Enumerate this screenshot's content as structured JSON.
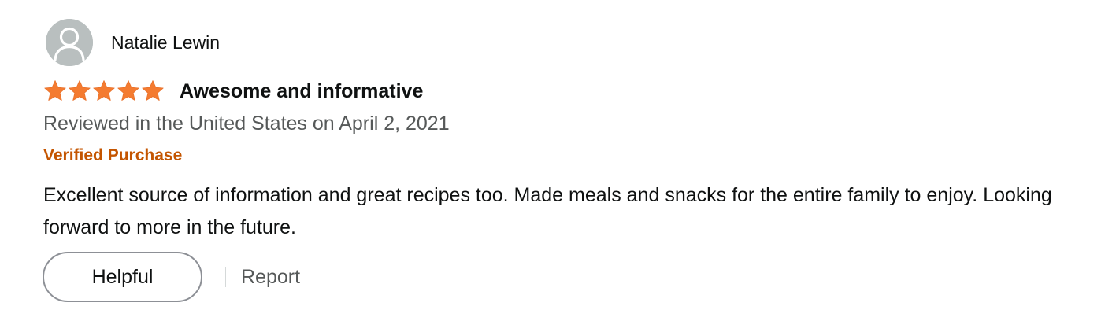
{
  "colors": {
    "star_fill": "#F47B30",
    "verified_text": "#C45500",
    "secondary_text": "#565959",
    "primary_text": "#0F1111",
    "avatar_bg": "#B9BFBF"
  },
  "reviewer": {
    "name": "Natalie Lewin",
    "avatar_icon": "user-silhouette-icon"
  },
  "rating": {
    "stars": 5,
    "max": 5,
    "icon": "star-icon"
  },
  "review": {
    "title": "Awesome and informative",
    "date_text": "Reviewed in the United States on April 2, 2021",
    "badge": "Verified Purchase",
    "body": "Excellent source of information and great recipes too. Made meals and snacks for the entire family to enjoy. Looking forward to more in the future."
  },
  "actions": {
    "helpful_label": "Helpful",
    "report_label": "Report"
  }
}
